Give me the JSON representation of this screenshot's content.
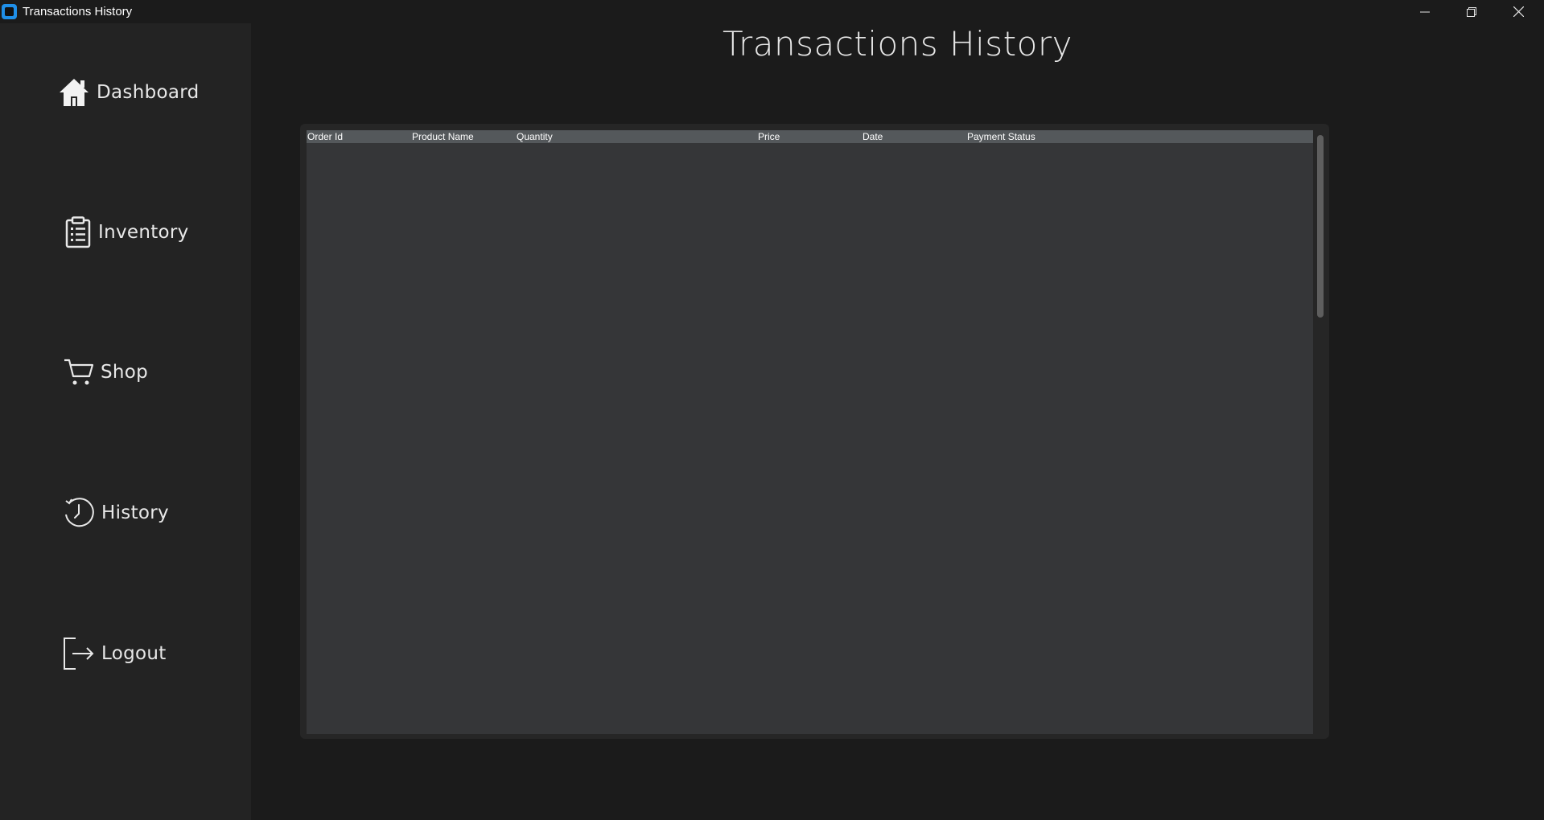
{
  "window": {
    "title": "Transactions History",
    "controls": [
      "minimize",
      "restore",
      "close"
    ]
  },
  "sidebar": {
    "items": [
      {
        "label": "Dashboard",
        "icon": "home-icon"
      },
      {
        "label": "Inventory",
        "icon": "clipboard-icon"
      },
      {
        "label": "Shop",
        "icon": "cart-icon"
      },
      {
        "label": "History",
        "icon": "history-clock-icon"
      },
      {
        "label": "Logout",
        "icon": "logout-icon"
      }
    ]
  },
  "main": {
    "title": "Transactions History",
    "table": {
      "columns": [
        "Order Id",
        "Product Name",
        "Quantity",
        "Price",
        "Date",
        "Payment Status"
      ],
      "rows": []
    }
  },
  "colors": {
    "app_icon": "#1f8fe8",
    "background": "#1b1b1b",
    "sidebar": "#232323",
    "table_body": "#353638",
    "table_header": "#54585b"
  }
}
